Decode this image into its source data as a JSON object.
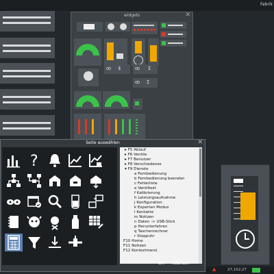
{
  "topbar": {
    "title": "Fabrik"
  },
  "popup": {
    "title": "widgets",
    "close": "✕",
    "sigma_label": "Σ",
    "s_label": "$"
  },
  "selector": {
    "title": "Seite auswählen",
    "close": "✕",
    "tree": [
      {
        "text": "F5 Ablauf",
        "level": 1,
        "marker": "▸"
      },
      {
        "text": "F6 Ventile",
        "level": 1,
        "marker": "▸"
      },
      {
        "text": "F7 Benutzer",
        "level": 1,
        "marker": "▸"
      },
      {
        "text": "F8 Verschiedenes",
        "level": 1,
        "marker": "▸"
      },
      {
        "text": "F9 Dienste",
        "level": 1,
        "marker": "▾"
      },
      {
        "text": "a Fernbedienung",
        "level": 2
      },
      {
        "text": "b Fernbedienung beenden",
        "level": 2
      },
      {
        "text": "c Fehlerliste",
        "level": 2
      },
      {
        "text": "e Ventiltest",
        "level": 2
      },
      {
        "text": "f Kalibrierung",
        "level": 2
      },
      {
        "text": "h Leistungsaufnahme",
        "level": 2
      },
      {
        "text": "j Konfiguration",
        "level": 2
      },
      {
        "text": "k Experten Modus",
        "level": 2
      },
      {
        "text": "l Kontakte",
        "level": 2
      },
      {
        "text": "m Notizen",
        "level": 2
      },
      {
        "text": "n Daten -> USB-Stick",
        "level": 2
      },
      {
        "text": "p Herunterfahren",
        "level": 2
      },
      {
        "text": "q Taschenrechner",
        "level": 2
      },
      {
        "text": "r Stoppuhr",
        "level": 2
      },
      {
        "text": "F10 Home",
        "level": 0
      },
      {
        "text": "F11 Notizen",
        "level": 0
      },
      {
        "text": "F12 Kontextmenü",
        "level": 0
      }
    ],
    "ok_label": "OK",
    "cancel_label": "Abbruch"
  },
  "status": {
    "coordinates": "27,152,27"
  },
  "colors": {
    "accent_green": "#3bc24a",
    "accent_orange": "#f0a800",
    "warn_red": "#d83a2a"
  },
  "icons": [
    "bar-chart-icon",
    "help-icon",
    "bell-icon",
    "trend-icon",
    "trend-edit-icon",
    "network-icon",
    "network-alt-icon",
    "machine-icon",
    "machine-sub-icon",
    "arrow-down-icon",
    "cow-icon",
    "calendar-check-icon",
    "search-icon",
    "beaker-icon",
    "computer-export-icon",
    "notebook-icon",
    "cow-face-icon",
    "cow-delete-icon",
    "milk-bottle-icon",
    "table-edit-icon",
    "calculator-icon",
    "funnel-icon",
    "drop-arrow-icon",
    "pipe-connect-icon"
  ]
}
